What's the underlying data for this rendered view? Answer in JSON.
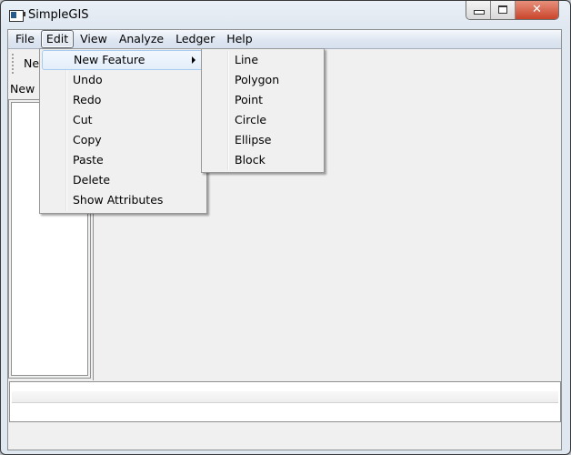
{
  "window": {
    "title": "SimpleGIS",
    "close_glyph": "✕"
  },
  "menubar": {
    "items": [
      "File",
      "Edit",
      "View",
      "Analyze",
      "Ledger",
      "Help"
    ],
    "open_menu": "Edit"
  },
  "toolbar": {
    "new_button": "New"
  },
  "left_panel": {
    "tab_label": "New"
  },
  "edit_menu": {
    "items": [
      {
        "label": "New Feature",
        "has_submenu": true,
        "highlighted": true
      },
      {
        "label": "Undo"
      },
      {
        "label": "Redo"
      },
      {
        "label": "Cut"
      },
      {
        "label": "Copy"
      },
      {
        "label": "Paste"
      },
      {
        "label": "Delete"
      },
      {
        "label": "Show Attributes"
      }
    ]
  },
  "new_feature_submenu": {
    "items": [
      "Line",
      "Polygon",
      "Point",
      "Circle",
      "Ellipse",
      "Block"
    ]
  }
}
